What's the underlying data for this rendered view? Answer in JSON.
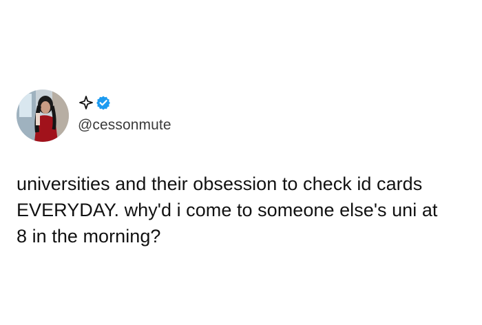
{
  "tweet": {
    "display_name_icon": "sparkle-icon",
    "verified_icon": "verified-badge-icon",
    "verified_color": "#1d9bf0",
    "handle": "@cessonmute",
    "text": "universities and their obsession to check id cards\nEVERYDAY. why'd i come to someone else's uni at\n8 in the morning?"
  },
  "colors": {
    "background": "#ffffff",
    "text": "#111111",
    "handle": "#3a3a3a"
  }
}
